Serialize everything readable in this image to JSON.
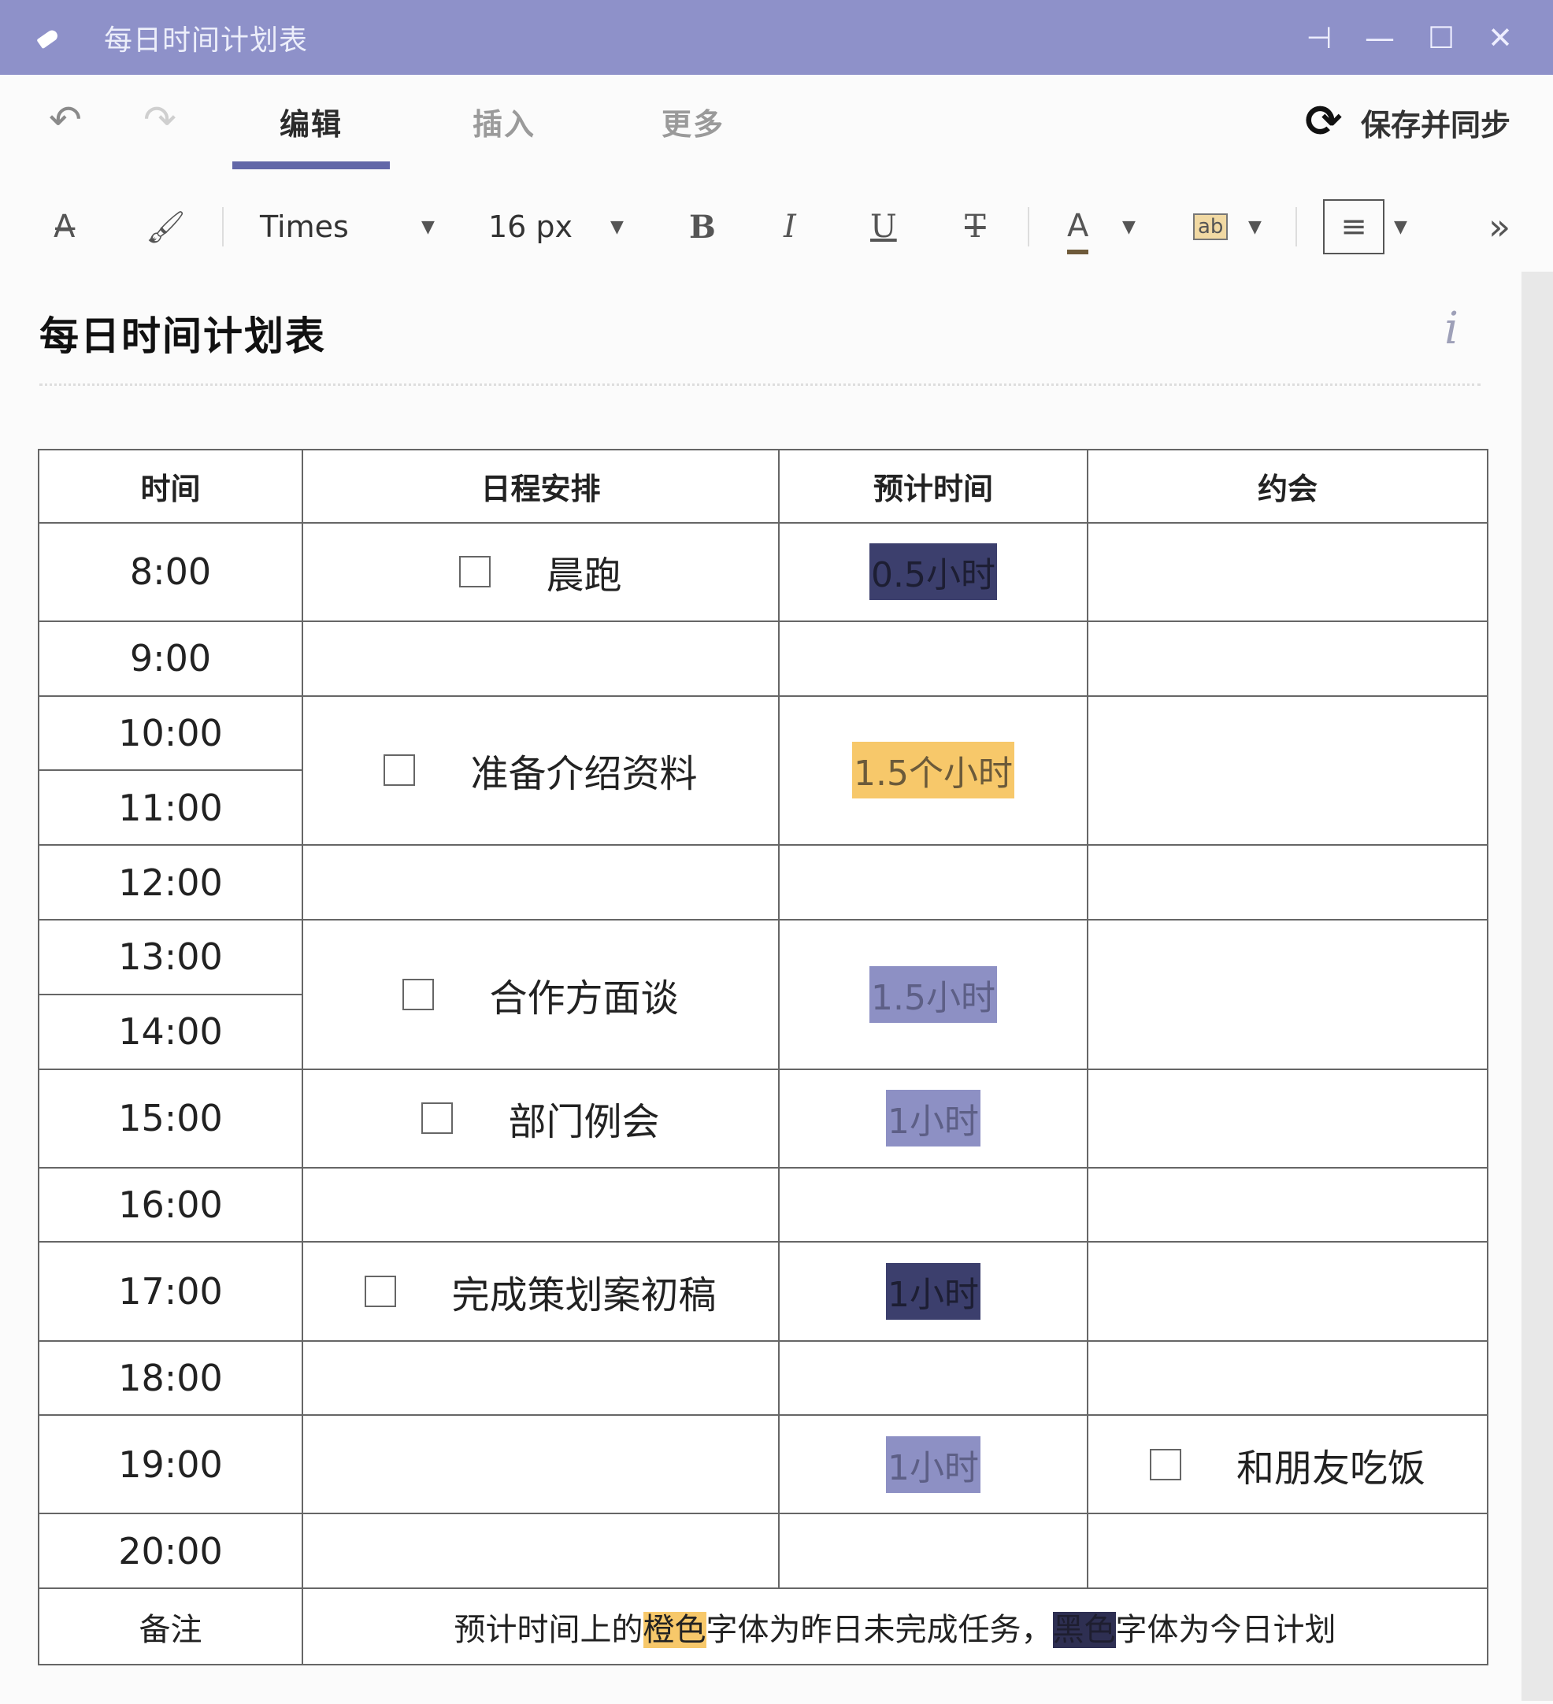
{
  "window": {
    "title": "每日时间计划表"
  },
  "menu": {
    "tabs": [
      "编辑",
      "插入",
      "更多"
    ],
    "sync_label": "保存并同步"
  },
  "toolbar": {
    "font_family": "Times",
    "font_size": "16 px",
    "bold": "B",
    "italic": "I",
    "underline": "U",
    "strike": "T",
    "font_color": "A",
    "highlight": "ab",
    "more": "»"
  },
  "document": {
    "title": "每日时间计划表"
  },
  "table": {
    "headers": [
      "时间",
      "日程安排",
      "预计时间",
      "约会"
    ],
    "times": [
      "8:00",
      "9:00",
      "10:00",
      "11:00",
      "12:00",
      "13:00",
      "14:00",
      "15:00",
      "16:00",
      "17:00",
      "18:00",
      "19:00",
      "20:00"
    ],
    "tasks": {
      "t1": {
        "label": "晨跑",
        "estimate": "0.5小时"
      },
      "t2": {
        "label": "准备介绍资料",
        "estimate": "1.5个小时"
      },
      "t3": {
        "label": "合作方面谈",
        "estimate": "1.5小时"
      },
      "t4": {
        "label": "部门例会",
        "estimate": "1小时"
      },
      "t5": {
        "label": "完成策划案初稿",
        "estimate": "1小时"
      },
      "t6": {
        "estimate": "1小时",
        "appointment": "和朋友吃饭"
      }
    },
    "notes_label": "备注",
    "notes": {
      "part1": "预计时间上的",
      "orange": "橙色",
      "part2": "字体为昨日未完成任务，",
      "dark": "黑色",
      "part3": "字体为今日计划"
    }
  },
  "colors": {
    "titlebar": "#8e91c9",
    "accent": "#6267a8",
    "dark_highlight": "#3c3f6d",
    "orange_highlight": "#f7c86a",
    "mid_highlight": "#8d90c4"
  }
}
